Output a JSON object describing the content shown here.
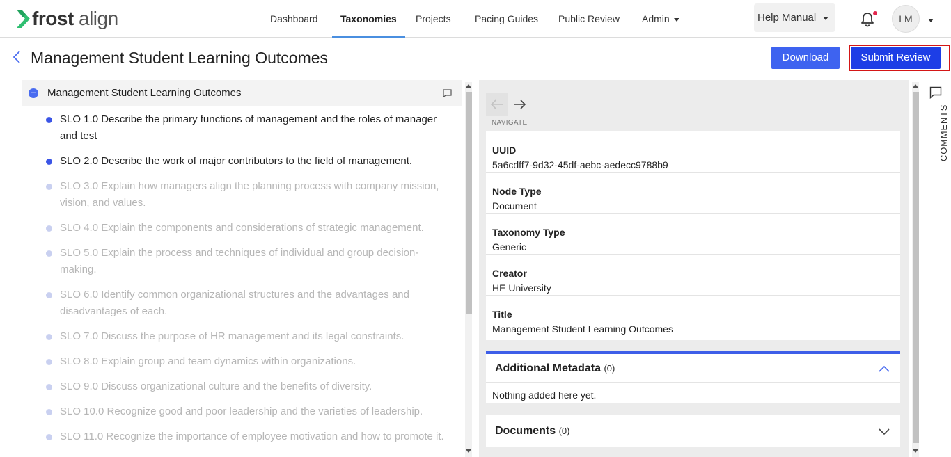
{
  "brand": {
    "name_bold": "frost",
    "name_light": " align"
  },
  "nav": {
    "items": [
      {
        "label": "Dashboard"
      },
      {
        "label": "Taxonomies"
      },
      {
        "label": "Projects"
      },
      {
        "label": "Pacing Guides"
      },
      {
        "label": "Public Review"
      },
      {
        "label": "Admin"
      }
    ],
    "active": "Taxonomies",
    "help_label": "Help Manual",
    "avatar_initials": "LM"
  },
  "header": {
    "title": "Management Student Learning Outcomes",
    "download_label": "Download",
    "submit_label": "Submit Review"
  },
  "tree": {
    "root_label": "Management Student Learning Outcomes",
    "collapse_symbol": "–",
    "items": [
      {
        "text": "SLO 1.0 Describe the primary functions of management and the roles of manager and test",
        "state": "on"
      },
      {
        "text": "SLO 2.0 Describe the work of major contributors to the field of management.",
        "state": "on"
      },
      {
        "text": "SLO 3.0 Explain how managers align the planning process with company mission, vision, and values.",
        "state": "off"
      },
      {
        "text": "SLO 4.0 Explain the components and considerations of strategic management.",
        "state": "off"
      },
      {
        "text": "SLO 5.0 Explain the process and techniques of individual and group decision-making.",
        "state": "off"
      },
      {
        "text": "SLO 6.0 Identify common organizational structures and the advantages and disadvantages of each.",
        "state": "off"
      },
      {
        "text": "SLO 7.0 Discuss the purpose of HR management and its legal constraints.",
        "state": "off"
      },
      {
        "text": "SLO 8.0 Explain group and team dynamics within organizations.",
        "state": "off"
      },
      {
        "text": "SLO 9.0 Discuss organizational culture and the benefits of diversity.",
        "state": "off"
      },
      {
        "text": "SLO 10.0 Recognize good and poor leadership and the varieties of leadership.",
        "state": "off"
      },
      {
        "text": "SLO 11.0 Recognize the importance of employee motivation and how to promote it.",
        "state": "off"
      }
    ]
  },
  "details": {
    "navigate_label": "NAVIGATE",
    "rows": [
      {
        "key": "UUID",
        "value": "5a6cdff7-9d32-45df-aebc-aedecc9788b9"
      },
      {
        "key": "Node Type",
        "value": "Document"
      },
      {
        "key": "Taxonomy Type",
        "value": "Generic"
      },
      {
        "key": "Creator",
        "value": "HE University"
      },
      {
        "key": "Title",
        "value": "Management Student Learning Outcomes"
      }
    ]
  },
  "additional_metadata": {
    "title": "Additional Metadata",
    "count": "(0)",
    "empty_text": "Nothing added here yet."
  },
  "documents": {
    "title": "Documents",
    "count": "(0)"
  },
  "comments_label": "COMMENTS",
  "colors": {
    "primary": "#3e63f0",
    "submit": "#1d3ee6",
    "highlight_frame": "#d41616",
    "notification_dot": "#e2264d"
  }
}
